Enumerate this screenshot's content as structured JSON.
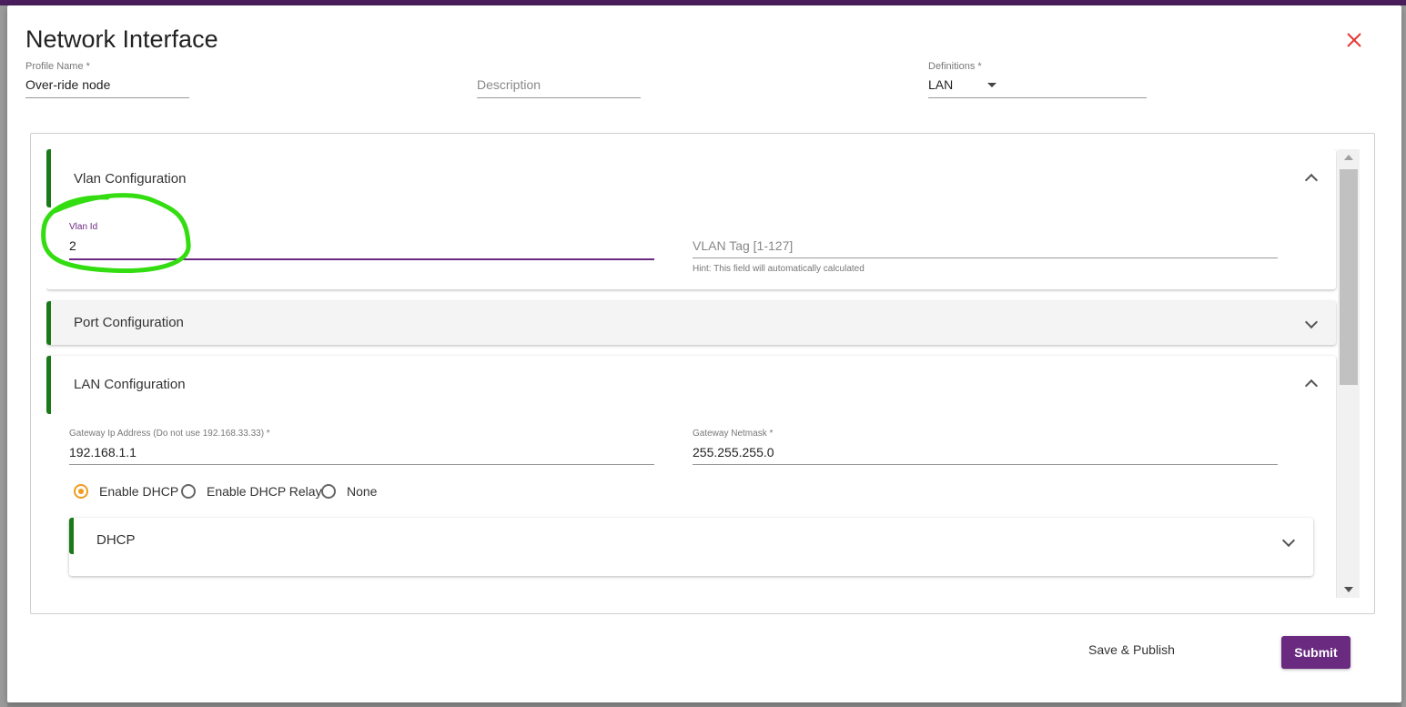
{
  "dialog": {
    "title": "Network Interface",
    "close_icon": "close-icon",
    "close_color": "#e53935"
  },
  "header_fields": {
    "profile_name": {
      "label": "Profile Name *",
      "value": "Over-ride node"
    },
    "description": {
      "placeholder": "Description"
    },
    "definitions": {
      "label": "Definitions *",
      "value": "LAN"
    }
  },
  "sections": {
    "vlan": {
      "title": "Vlan Configuration",
      "vlan_id": {
        "label": "Vlan Id",
        "value": "2"
      },
      "vlan_tag": {
        "placeholder": "VLAN Tag [1-127]",
        "hint": "Hint: This field will automatically calculated"
      }
    },
    "port": {
      "title": "Port Configuration"
    },
    "lan": {
      "title": "LAN Configuration",
      "gateway_ip": {
        "label": "Gateway Ip Address (Do not use 192.168.33.33) *",
        "value": "192.168.1.1"
      },
      "gateway_netmask": {
        "label": "Gateway Netmask *",
        "value": "255.255.255.0"
      },
      "dhcp_options": [
        {
          "label": "Enable DHCP",
          "checked": true
        },
        {
          "label": "Enable DHCP Relay",
          "checked": false
        },
        {
          "label": "None",
          "checked": false
        }
      ],
      "dhcp": {
        "title": "DHCP"
      }
    }
  },
  "footer": {
    "save_publish_label": "Save & Publish",
    "submit_label": "Submit"
  },
  "colors": {
    "accent_purple": "#6a2a80",
    "section_bar_green": "#1a7a1a",
    "radio_checked": "#f29b1d",
    "annotation_green": "#33dd11"
  }
}
